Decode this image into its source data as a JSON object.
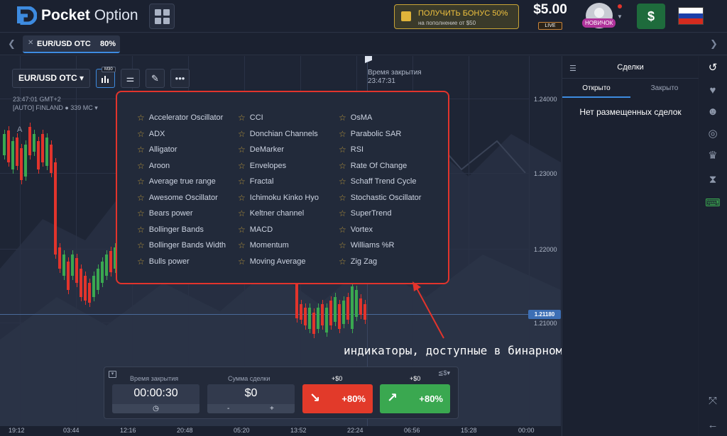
{
  "header": {
    "logo_bold": "Pocket",
    "logo_thin": "Option",
    "bonus_title": "ПОЛУЧИТЬ БОНУС 50%",
    "bonus_sub": "на пополнение от $50",
    "balance": "$5.00",
    "account_type": "LIVE",
    "user_badge": "НОВИЧОК",
    "deposit_label": "$"
  },
  "tabs": [
    {
      "pair": "EUR/USD OTC",
      "payout": "80%"
    }
  ],
  "chart_toolbar": {
    "pair": "EUR/USD OTC ▾",
    "timeframe_badge": "M30"
  },
  "chart_meta": {
    "clock": "23:47:01 GMT+2",
    "server": "[AUTO] FINLAND ● 339 МС ▾",
    "close_label": "Время закрытия",
    "close_time": "23:47:31"
  },
  "price_axis": [
    "1.24000",
    "1.23000",
    "1.22000",
    "1.21000"
  ],
  "current_price": "1.21180",
  "time_axis": [
    "19:12",
    "03:44",
    "12:16",
    "20:48",
    "05:20",
    "13:52",
    "22:24",
    "06:56",
    "15:28",
    "00:00"
  ],
  "indicators": {
    "col1": [
      "Accelerator Oscillator",
      "ADX",
      "Alligator",
      "Aroon",
      "Average true range",
      "Awesome Oscillator",
      "Bears power",
      "Bollinger Bands",
      "Bollinger Bands Width",
      "Bulls power"
    ],
    "col2": [
      "CCI",
      "Donchian Channels",
      "DeMarker",
      "Envelopes",
      "Fractal",
      "Ichimoku Kinko Hyo",
      "Keltner channel",
      "MACD",
      "Momentum",
      "Moving Average"
    ],
    "col3": [
      "OsMA",
      "Parabolic SAR",
      "RSI",
      "Rate Of Change",
      "Schaff Trend Cycle",
      "Stochastic Oscillator",
      "SuperTrend",
      "Vortex",
      "Williams %R",
      "Zig Zag"
    ]
  },
  "annotation": "индикаторы, доступные в бинарном терминале",
  "trade_panel": {
    "time_label": "Время закрытия",
    "time_value": "00:00:30",
    "amount_label": "Сумма сделки",
    "amount_value": "$0",
    "minus": "-",
    "plus": "+",
    "down_top": "+$0",
    "down_pct": "+80%",
    "up_top": "+$0",
    "up_pct": "+80%",
    "currency_toggle": "≦$▾"
  },
  "deals_panel": {
    "title": "Сделки",
    "tab_open": "Открыто",
    "tab_closed": "Закрыто",
    "empty": "Нет размещенных сделок"
  },
  "colors": {
    "accent": "#3d8be0",
    "red": "#e2342c",
    "green": "#3aa850",
    "gold": "#f0c23f"
  },
  "sidebar_icons": [
    "history-icon",
    "heart-pulse-icon",
    "people-icon",
    "target-icon",
    "trophy-icon",
    "hourglass-icon",
    "keyboard-icon",
    "fullscreen-icon",
    "left-arrow-icon"
  ]
}
